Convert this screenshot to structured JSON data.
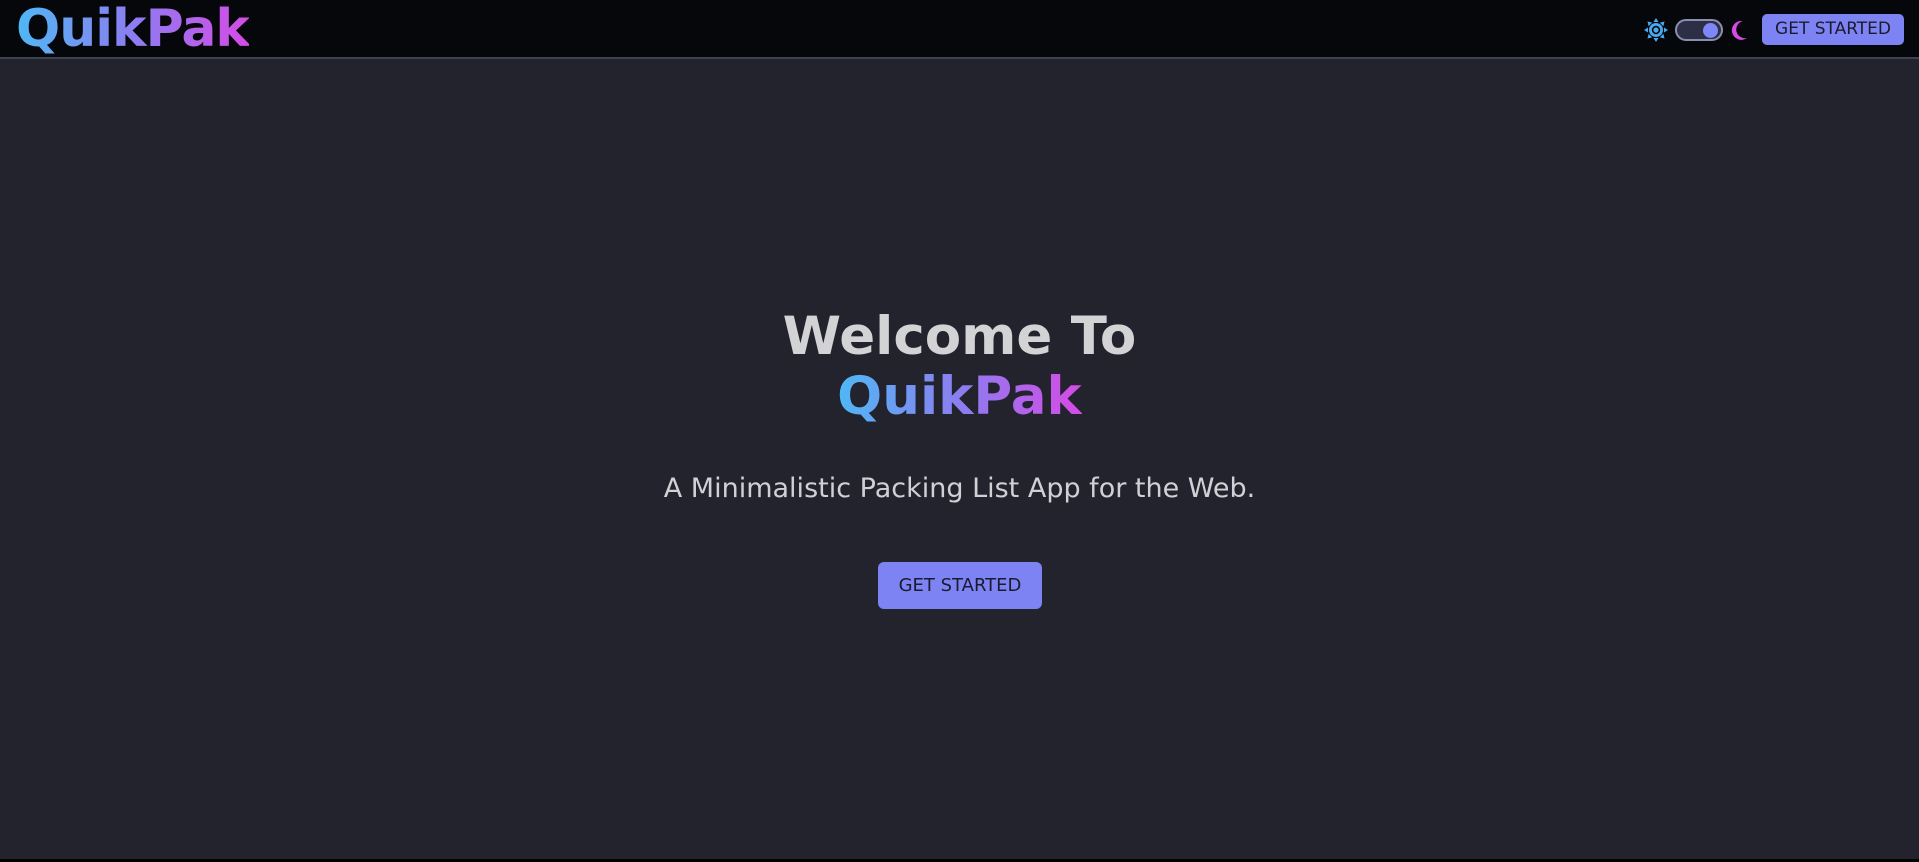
{
  "navbar": {
    "logo_text": "QuikPak",
    "get_started_label": "GET STARTED",
    "theme_toggle": {
      "light_icon": "sun-icon",
      "dark_icon": "moon-icon",
      "mode": "dark"
    }
  },
  "hero": {
    "heading": "Welcome To",
    "brand": "QuikPak",
    "tagline": "A Minimalistic Packing List App for the Web.",
    "cta_label": "GET STARTED"
  },
  "colors": {
    "page_background": "#23232e",
    "navbar_background": "#06070b",
    "accent": "#7e83f3",
    "brand_gradient_start": "#4fb8f5",
    "brand_gradient_mid": "#8b7ef0",
    "brand_gradient_end": "#d64be6"
  }
}
